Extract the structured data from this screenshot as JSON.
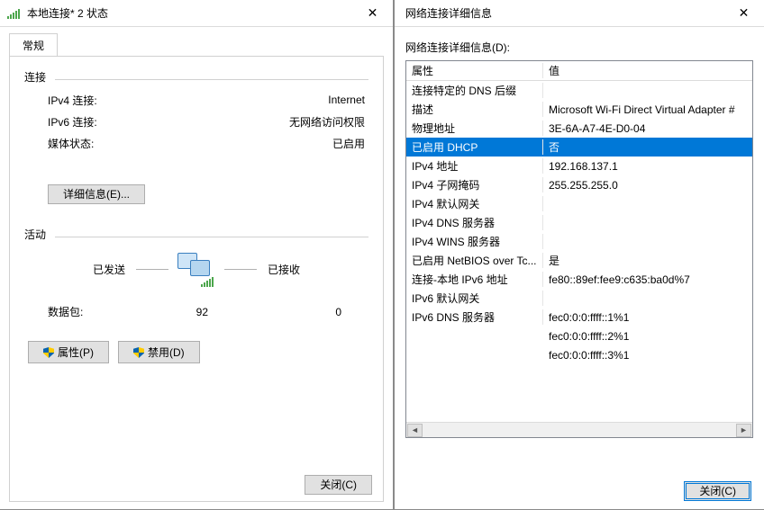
{
  "left": {
    "title": "本地连接* 2 状态",
    "tab_label": "常规",
    "connection_label": "连接",
    "rows": {
      "ipv4_k": "IPv4 连接:",
      "ipv4_v": "Internet",
      "ipv6_k": "IPv6 连接:",
      "ipv6_v": "无网络访问权限",
      "media_k": "媒体状态:",
      "media_v": "已启用"
    },
    "details_button": "详细信息(E)...",
    "activity_label": "活动",
    "sent_label": "已发送",
    "received_label": "已接收",
    "packets_label": "数据包:",
    "packets_sent": "92",
    "packets_received": "0",
    "properties_button": "属性(P)",
    "disable_button": "禁用(D)",
    "close_button": "关闭(C)"
  },
  "right": {
    "title": "网络连接详细信息",
    "caption": "网络连接详细信息(D):",
    "header_property": "属性",
    "header_value": "值",
    "rows": [
      {
        "p": "连接特定的 DNS 后缀",
        "v": ""
      },
      {
        "p": "描述",
        "v": "Microsoft Wi-Fi Direct Virtual Adapter #"
      },
      {
        "p": "物理地址",
        "v": "3E-6A-A7-4E-D0-04"
      },
      {
        "p": "已启用 DHCP",
        "v": "否",
        "selected": true
      },
      {
        "p": "IPv4 地址",
        "v": "192.168.137.1"
      },
      {
        "p": "IPv4 子网掩码",
        "v": "255.255.255.0"
      },
      {
        "p": "IPv4 默认网关",
        "v": ""
      },
      {
        "p": "IPv4 DNS 服务器",
        "v": ""
      },
      {
        "p": "IPv4 WINS 服务器",
        "v": ""
      },
      {
        "p": "已启用 NetBIOS over Tc...",
        "v": "是"
      },
      {
        "p": "连接-本地 IPv6 地址",
        "v": "fe80::89ef:fee9:c635:ba0d%7"
      },
      {
        "p": "IPv6 默认网关",
        "v": ""
      },
      {
        "p": "IPv6 DNS 服务器",
        "v": "fec0:0:0:ffff::1%1"
      },
      {
        "p": "",
        "v": "fec0:0:0:ffff::2%1"
      },
      {
        "p": "",
        "v": "fec0:0:0:ffff::3%1"
      }
    ],
    "close_button": "关闭(C)"
  }
}
